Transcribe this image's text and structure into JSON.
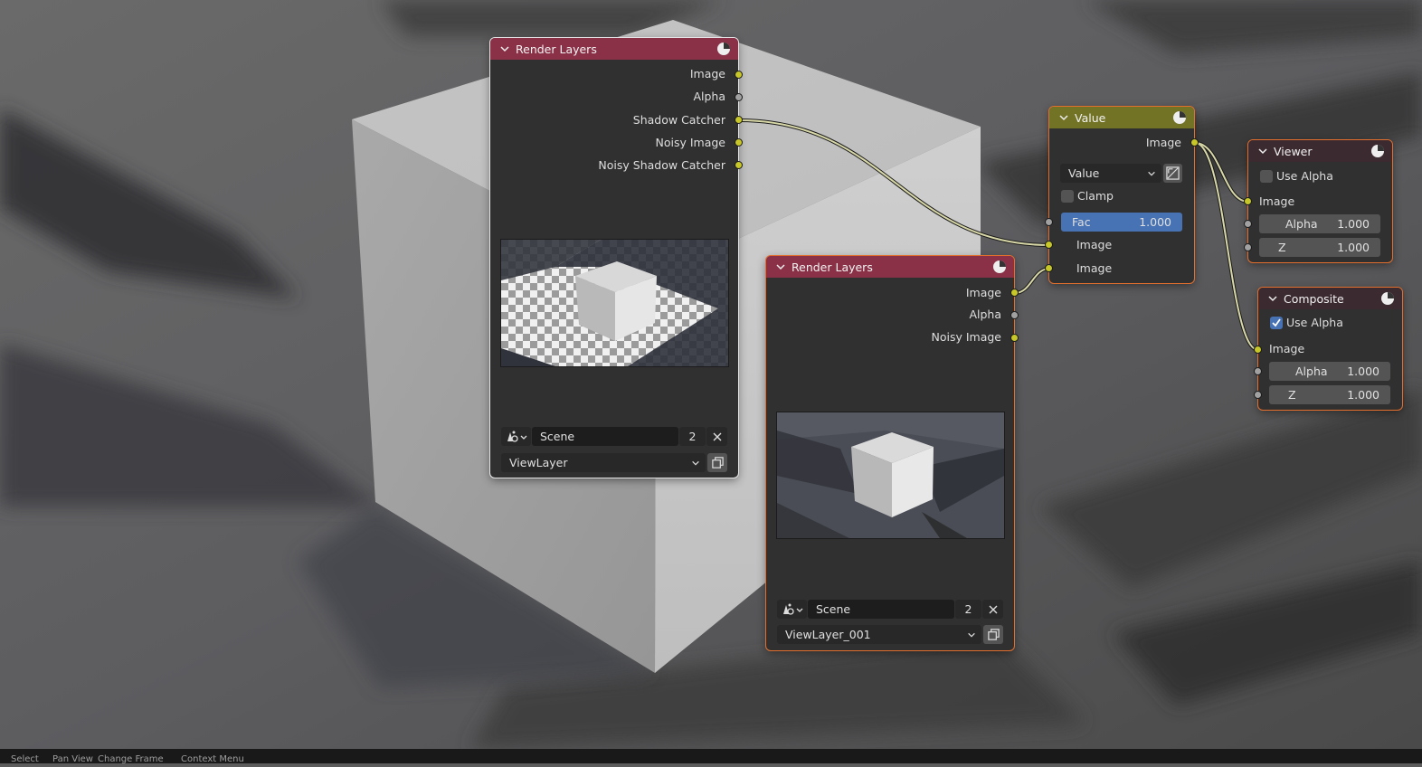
{
  "nodes": {
    "render_layers_1": {
      "title": "Render Layers",
      "outputs": [
        "Image",
        "Alpha",
        "Shadow Catcher",
        "Noisy Image",
        "Noisy Shadow Catcher"
      ],
      "scene": {
        "name": "Scene",
        "users": "2"
      },
      "view_layer": "ViewLayer"
    },
    "render_layers_2": {
      "title": "Render Layers",
      "outputs": [
        "Image",
        "Alpha",
        "Noisy Image"
      ],
      "scene": {
        "name": "Scene",
        "users": "2"
      },
      "view_layer": "ViewLayer_001"
    },
    "value": {
      "title": "Value",
      "output": "Image",
      "dropdown": "Value",
      "clamp_label": "Clamp",
      "clamp_checked": false,
      "fac": {
        "label": "Fac",
        "value": "1.000"
      },
      "inputs": [
        "Image",
        "Image"
      ]
    },
    "viewer": {
      "title": "Viewer",
      "use_alpha_label": "Use Alpha",
      "use_alpha_checked": false,
      "image_label": "Image",
      "alpha": {
        "label": "Alpha",
        "value": "1.000"
      },
      "z": {
        "label": "Z",
        "value": "1.000"
      }
    },
    "composite": {
      "title": "Composite",
      "use_alpha_label": "Use Alpha",
      "use_alpha_checked": true,
      "image_label": "Image",
      "alpha": {
        "label": "Alpha",
        "value": "1.000"
      },
      "z": {
        "label": "Z",
        "value": "1.000"
      }
    }
  },
  "colors": {
    "render_layers_header": "#8a3147",
    "value_header": "#737326",
    "output_header": "#3b2a30",
    "socket_color": "#c7c729",
    "socket_float": "#a1a1a1",
    "selection_active": "#e6e6e6",
    "selection": "#e36f2e",
    "link": "#d8d8a8",
    "accent": "#4772b3"
  },
  "icons": {
    "node_header": "render-sphere-icon",
    "scene_browse": "scene-icon",
    "unlink": "x-icon",
    "view_layer_copy": "copy-icon",
    "value_picker": "curve-icon",
    "collapse": "chevron-down-icon"
  },
  "statusbar": [
    "Select",
    "Pan View",
    "Change Frame",
    "Context Menu"
  ]
}
